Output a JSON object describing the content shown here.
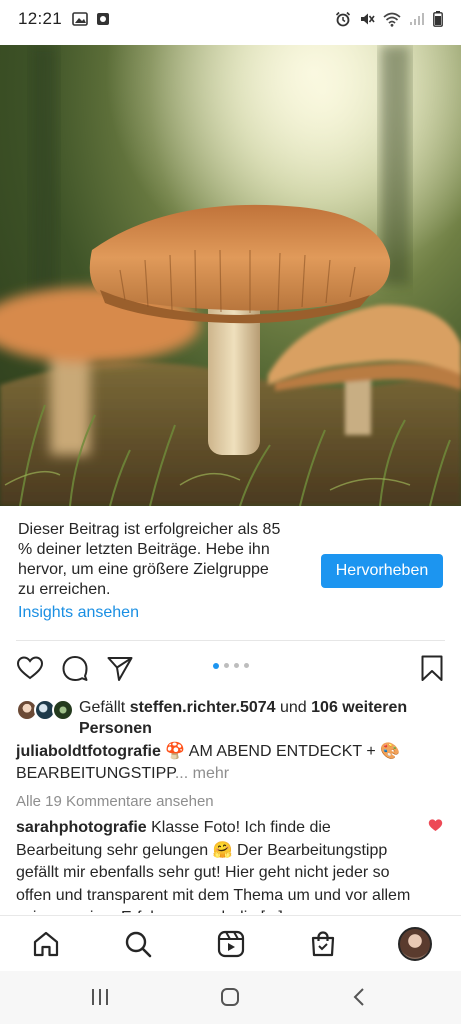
{
  "status_bar": {
    "time": "12:21"
  },
  "promo": {
    "text": "Dieser Beitrag ist erfolgreicher als 85 % deiner letzten Beiträge. Hebe ihn hervor, um eine größere Zielgruppe zu erreichen.",
    "link": "Insights ansehen",
    "button": "Hervorheben"
  },
  "likes": {
    "prefix": "Gefällt ",
    "user": "steffen.richter.5074",
    "middle": " und ",
    "others": "106 weiteren Personen"
  },
  "caption": {
    "user": "juliaboldtfotografie",
    "text": " 🍄 AM ABEND ENTDECKT + 🎨 BEARBEITUNGSTIPP",
    "ellipsis": "...",
    "more": " mehr"
  },
  "comments_link": "Alle 19 Kommentare ansehen",
  "comment": {
    "user": "sarahphotografie",
    "text": " Klasse Foto! Ich finde die Bearbeitung sehr gelungen 🤗 Der Bearbeitungstipp gefällt mir ebenfalls sehr gut! Hier geht nicht jeder so offen und transparent mit dem Thema um und vor allem zeigen meiner Erfahrung nach die [...]"
  },
  "icons": {
    "like": "heart-outline-icon",
    "comment": "comment-bubble-icon",
    "share": "paper-plane-icon",
    "save": "bookmark-icon",
    "comment_like": "heart-filled-icon",
    "nav": [
      "home-icon",
      "search-icon",
      "reels-icon",
      "shop-icon",
      "profile-avatar"
    ],
    "android": [
      "recent-apps-icon",
      "home-circle-icon",
      "back-chevron-icon"
    ]
  },
  "colors": {
    "accent": "#1c95f0",
    "heart": "#ed4956",
    "muted": "#8e8e8e"
  },
  "carousel": {
    "total": 4,
    "active": 1
  }
}
